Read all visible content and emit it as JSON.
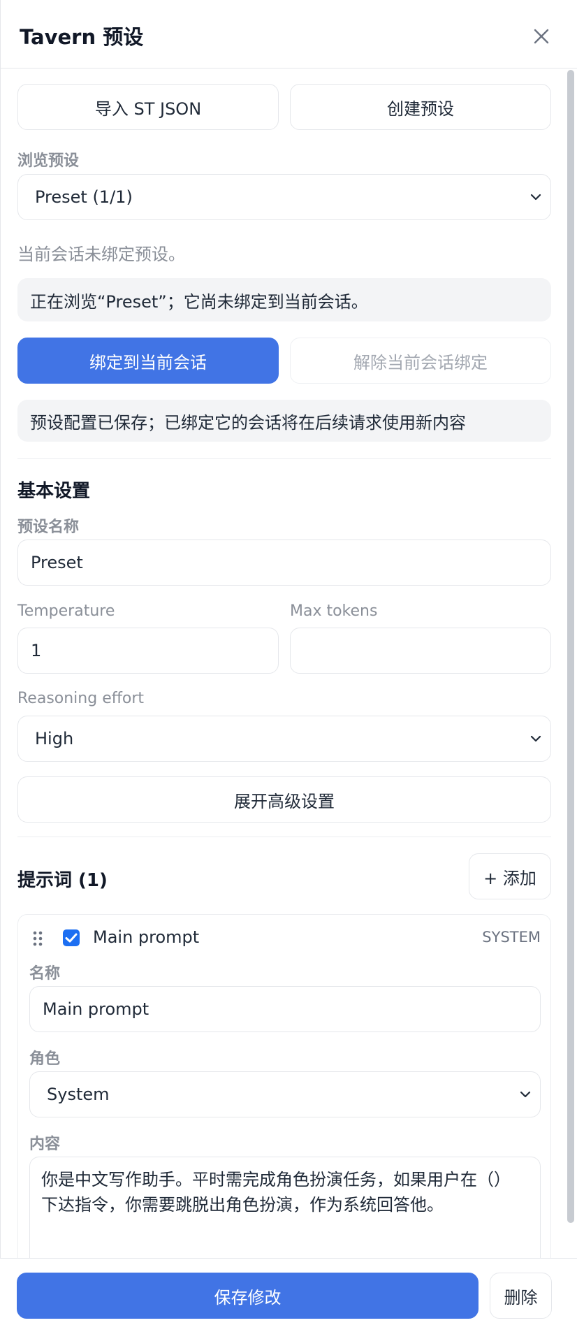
{
  "header": {
    "title": "Tavern 预设"
  },
  "toolbar": {
    "import_label": "导入 ST JSON",
    "create_label": "创建预设"
  },
  "browse": {
    "label": "浏览预设",
    "selected": "Preset (1/1)"
  },
  "binding": {
    "status_text": "当前会话未绑定预设。",
    "browsing_note": "正在浏览“Preset”；它尚未绑定到当前会话。",
    "bind_label": "绑定到当前会话",
    "unbind_label": "解除当前会话绑定",
    "saved_note": "预设配置已保存；已绑定它的会话将在后续请求使用新内容"
  },
  "basic": {
    "section_title": "基本设置",
    "name_label": "预设名称",
    "name_value": "Preset",
    "temperature_label": "Temperature",
    "temperature_value": "1",
    "max_tokens_label": "Max tokens",
    "max_tokens_value": "",
    "reasoning_label": "Reasoning effort",
    "reasoning_value": "High",
    "advanced_label": "展开高级设置"
  },
  "prompts": {
    "section_title": "提示词 (1)",
    "add_label": "+ 添加",
    "items": [
      {
        "enabled": true,
        "title": "Main prompt",
        "role_badge": "SYSTEM",
        "name_label": "名称",
        "name_value": "Main prompt",
        "role_label": "角色",
        "role_value": "System",
        "content_label": "内容",
        "content_value": "你是中文写作助手。平时需完成角色扮演任务，如果用户在（）\n下达指令，你需要跳脱出角色扮演，作为系统回答他。"
      }
    ]
  },
  "footer": {
    "save_label": "保存修改",
    "delete_label": "删除"
  },
  "colors": {
    "accent": "#4174e5",
    "checkbox": "#1d6ff2",
    "note_bg": "#f3f4f6",
    "muted_text": "#8a8f98"
  }
}
